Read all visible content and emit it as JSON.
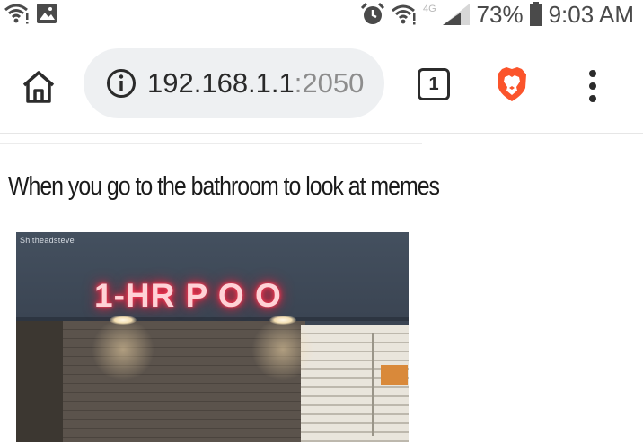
{
  "status_bar": {
    "battery_percent": "73%",
    "time": "9:03 AM",
    "network_label": "4G"
  },
  "toolbar": {
    "url_host": "192.168.1.1",
    "url_port": ":2050",
    "tab_count": "1"
  },
  "post": {
    "caption": "When you go to the bathroom to look at memes",
    "image": {
      "watermark": "Shitheadsteve",
      "sign_text": "1-HR P O O"
    }
  },
  "colors": {
    "brave_orange": "#fb542b",
    "neon_red": "#ff2846"
  },
  "icons": {
    "status_left": [
      "wifi-icon",
      "image-icon"
    ],
    "status_right": [
      "alarm-icon",
      "wifi-icon",
      "signal-icon",
      "battery-icon"
    ],
    "toolbar": [
      "home-icon",
      "info-icon",
      "brave-lion-icon",
      "more-vert-icon"
    ]
  }
}
